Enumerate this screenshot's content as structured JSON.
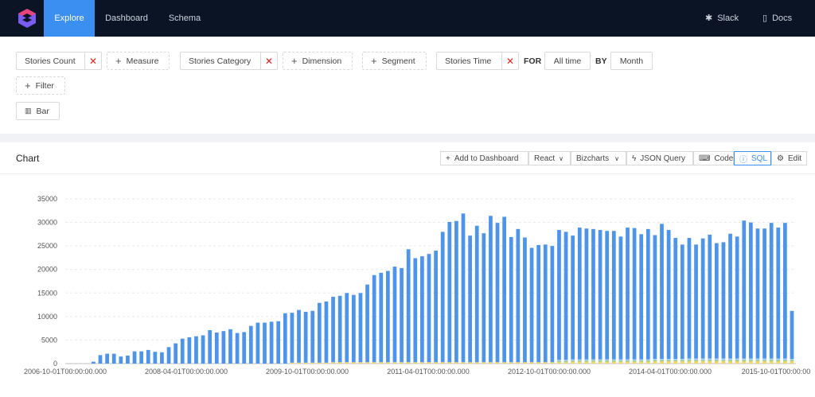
{
  "nav": {
    "items": [
      {
        "label": "Explore",
        "active": true
      },
      {
        "label": "Dashboard",
        "active": false
      },
      {
        "label": "Schema",
        "active": false
      }
    ],
    "slack_label": "Slack",
    "docs_label": "Docs"
  },
  "query": {
    "measure_value": "Stories Count",
    "measure_add_label": "Measure",
    "dimension_value": "Stories Category",
    "dimension_add_label": "Dimension",
    "segment_add_label": "Segment",
    "time_value": "Stories Time",
    "for_label": "FOR",
    "range_value": "All time",
    "by_label": "BY",
    "granularity_value": "Month",
    "filter_add_label": "Filter",
    "chart_type_label": "Bar"
  },
  "card": {
    "title": "Chart",
    "toolbar": {
      "add_dashboard": "Add to Dashboard",
      "framework": "React",
      "library": "Bizcharts",
      "json_query": "JSON Query",
      "code": "Code",
      "sql": "SQL",
      "edit": "Edit"
    }
  },
  "colors": {
    "navbar_bg": "#0b1425",
    "accent": "#3b8ff0",
    "bar_main": "#4e94e8",
    "bar_green": "#8fd16c",
    "bar_yellow": "#f2d46b",
    "remove_x": "#e02020"
  },
  "chart_data": {
    "type": "bar",
    "stacked": true,
    "x_tick_labels": [
      "2006-10-01T00:00:00.000",
      "2008-04-01T00:00:00.000",
      "2009-10-01T00:00:00.000",
      "2011-04-01T00:00:00.000",
      "2012-10-01T00:00:00.000",
      "2014-04-01T00:00:00.000",
      "2015-10-01T00:00:00"
    ],
    "y_ticks": [
      0,
      5000,
      10000,
      15000,
      20000,
      25000,
      30000,
      35000
    ],
    "ylim": [
      0,
      35000
    ],
    "grid": true,
    "series": [
      {
        "values": [
          0,
          0,
          0,
          0,
          400,
          1800,
          2100,
          2100,
          1500,
          1700,
          2600,
          2600,
          2900,
          2500,
          2400,
          3500,
          4300,
          5300,
          5600,
          5800,
          6000,
          7100,
          6600,
          6900,
          7300,
          6500,
          6700,
          8000,
          8700,
          8700,
          8900,
          9000,
          10700,
          10600,
          11200,
          10800,
          11000,
          12700,
          13000,
          13900,
          14100,
          14700,
          14300,
          14700,
          16500,
          18500,
          19000,
          19400,
          20300,
          20000,
          24000,
          22100,
          22500,
          23000,
          23700,
          27700,
          29800,
          30000,
          31600,
          26900,
          29000,
          27400,
          31100,
          29600,
          30900,
          26600,
          28300,
          26500,
          24300,
          24900,
          25000,
          24700,
          27600,
          27200,
          26300,
          28000,
          27800,
          27700,
          27500,
          27300,
          27300,
          26100,
          28000,
          27900,
          26600,
          27700,
          26300,
          28700,
          27400,
          25700,
          24300,
          25600,
          24200,
          25500,
          26300,
          24500,
          24700,
          26500,
          25900,
          29300,
          28900,
          27600,
          27600,
          28800,
          27800,
          28800,
          10200
        ]
      },
      {
        "values": [
          0,
          0,
          0,
          0,
          0,
          0,
          0,
          0,
          0,
          0,
          0,
          0,
          0,
          0,
          0,
          0,
          0,
          0,
          0,
          0,
          0,
          0,
          0,
          0,
          0,
          0,
          0,
          0,
          0,
          0,
          0,
          0,
          0,
          0,
          0,
          0,
          0,
          0,
          0,
          0,
          0,
          0,
          0,
          0,
          0,
          0,
          0,
          0,
          0,
          0,
          0,
          0,
          0,
          0,
          0,
          0,
          0,
          0,
          0,
          0,
          0,
          0,
          0,
          0,
          0,
          0,
          0,
          0,
          0,
          0,
          0,
          0,
          200,
          200,
          200,
          200,
          200,
          200,
          200,
          200,
          200,
          200,
          200,
          200,
          200,
          200,
          200,
          200,
          200,
          200,
          200,
          200,
          200,
          200,
          200,
          200,
          200,
          200,
          200,
          200,
          200,
          200,
          200,
          200,
          200,
          200,
          200
        ]
      },
      {
        "values": [
          0,
          0,
          0,
          0,
          0,
          0,
          0,
          0,
          0,
          0,
          0,
          0,
          0,
          0,
          0,
          0,
          0,
          0,
          0,
          0,
          0,
          0,
          0,
          0,
          0,
          0,
          0,
          0,
          0,
          0,
          0,
          0,
          0,
          200,
          200,
          200,
          200,
          200,
          200,
          300,
          300,
          300,
          300,
          300,
          300,
          300,
          300,
          300,
          300,
          300,
          300,
          300,
          300,
          300,
          300,
          300,
          300,
          300,
          300,
          300,
          300,
          300,
          300,
          300,
          300,
          300,
          300,
          300,
          300,
          300,
          300,
          300,
          300,
          300,
          400,
          400,
          400,
          400,
          400,
          400,
          400,
          400,
          400,
          400,
          400,
          400,
          500,
          500,
          500,
          500,
          500,
          500,
          500,
          500,
          500,
          500,
          500,
          500,
          500,
          500,
          500,
          500,
          500,
          500,
          500,
          500,
          500
        ]
      },
      {
        "values": [
          0,
          0,
          0,
          0,
          0,
          0,
          0,
          0,
          0,
          0,
          0,
          0,
          0,
          0,
          0,
          0,
          0,
          0,
          0,
          0,
          0,
          0,
          0,
          0,
          0,
          0,
          0,
          0,
          0,
          0,
          0,
          0,
          0,
          0,
          0,
          0,
          0,
          0,
          0,
          0,
          0,
          0,
          0,
          0,
          0,
          0,
          0,
          0,
          0,
          0,
          0,
          0,
          0,
          0,
          0,
          0,
          0,
          0,
          0,
          0,
          0,
          0,
          0,
          0,
          0,
          0,
          0,
          0,
          0,
          0,
          0,
          0,
          300,
          300,
          300,
          300,
          300,
          300,
          300,
          300,
          300,
          300,
          300,
          300,
          300,
          300,
          300,
          300,
          300,
          300,
          300,
          400,
          400,
          400,
          400,
          400,
          400,
          400,
          400,
          400,
          400,
          400,
          400,
          400,
          400,
          400,
          300
        ]
      }
    ]
  }
}
